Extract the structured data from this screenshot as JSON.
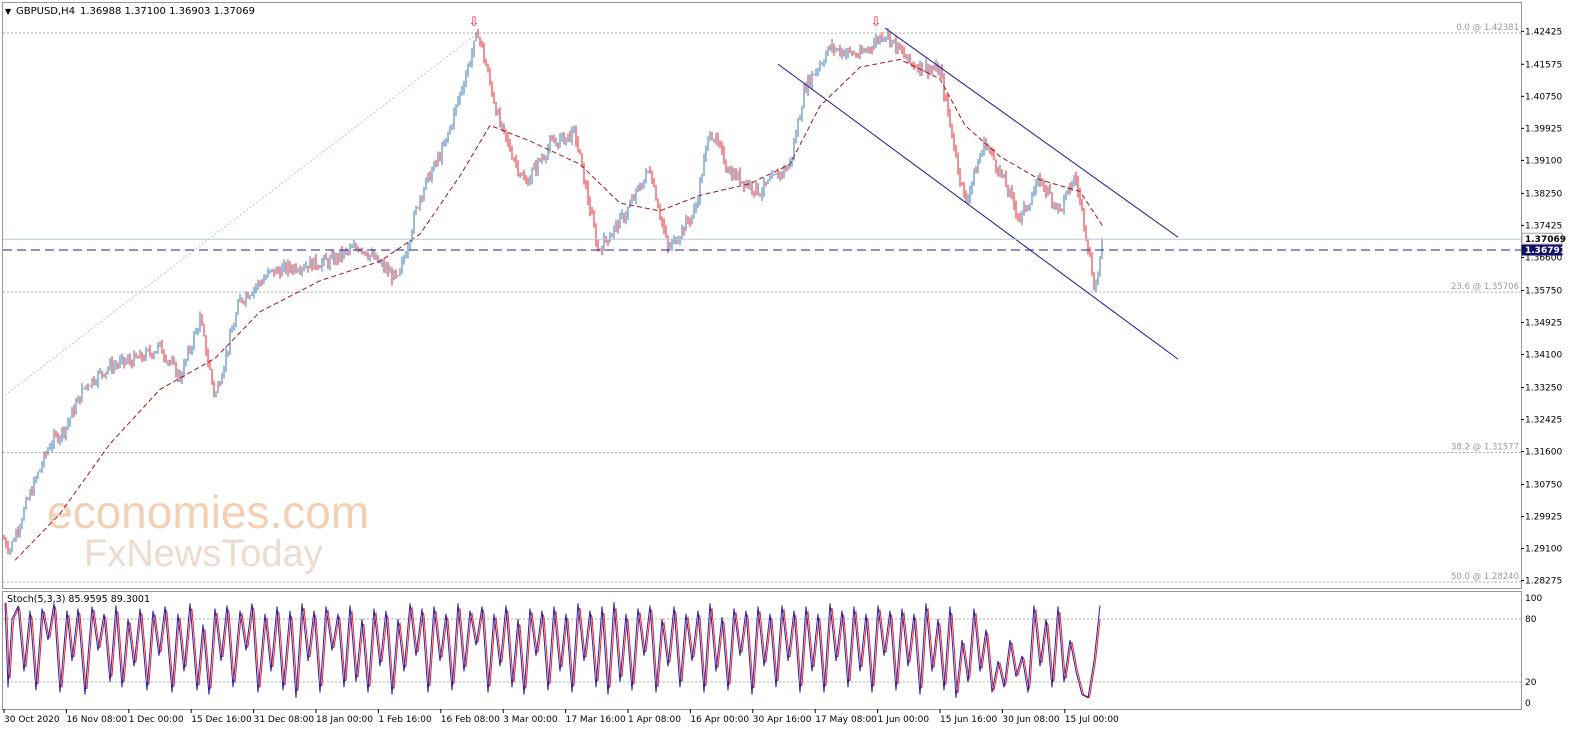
{
  "header": {
    "arrow_glyph": "▼",
    "symbol_label": "GBPUSD,H4",
    "ohlc": "1.36988 1.37100 1.36903 1.37069"
  },
  "watermark": {
    "line1": "economies.com",
    "line2": "FxNewsToday",
    "color": "#f3d0b4"
  },
  "colors": {
    "bull": "#3a78b4",
    "bear": "#e8202a",
    "ma": "#a01818",
    "channel": "#1a1a8c",
    "hline": "#2020a0",
    "stoch_main": "#2222aa",
    "stoch_signal": "#e8202a",
    "badge_bg": "#10106a"
  },
  "chart_data": [
    {
      "type": "candlestick",
      "symbol": "GBPUSD",
      "timeframe": "H4",
      "y_range": [
        1.2824,
        1.4251
      ],
      "y_ticks": [
        "1.42425",
        "1.41575",
        "1.40750",
        "1.39925",
        "1.39100",
        "1.38250",
        "1.37425",
        "1.36600",
        "1.35750",
        "1.34925",
        "1.34100",
        "1.33250",
        "1.32425",
        "1.31600",
        "1.30750",
        "1.29925",
        "1.29100",
        "1.28275"
      ],
      "x_ticks": [
        "30 Oct 2020",
        "16 Nov 08:00",
        "1 Dec 00:00",
        "15 Dec 16:00",
        "31 Dec 08:00",
        "18 Jan 00:00",
        "1 Feb 16:00",
        "16 Feb 08:00",
        "3 Mar 00:00",
        "17 Mar 16:00",
        "1 Apr 08:00",
        "16 Apr 00:00",
        "30 Apr 16:00",
        "17 May 08:00",
        "1 Jun 00:00",
        "15 Jun 16:00",
        "30 Jun 08:00",
        "15 Jul 00:00"
      ],
      "price_path": [
        [
          0,
          1.295
        ],
        [
          10,
          1.291
        ],
        [
          30,
          1.305
        ],
        [
          50,
          1.318
        ],
        [
          65,
          1.322
        ],
        [
          85,
          1.333
        ],
        [
          110,
          1.338
        ],
        [
          140,
          1.34
        ],
        [
          160,
          1.343
        ],
        [
          180,
          1.335
        ],
        [
          200,
          1.35
        ],
        [
          215,
          1.33
        ],
        [
          240,
          1.355
        ],
        [
          270,
          1.362
        ],
        [
          300,
          1.364
        ],
        [
          330,
          1.365
        ],
        [
          360,
          1.369
        ],
        [
          398,
          1.36
        ],
        [
          420,
          1.382
        ],
        [
          445,
          1.395
        ],
        [
          478,
          1.424
        ],
        [
          500,
          1.4
        ],
        [
          525,
          1.385
        ],
        [
          550,
          1.395
        ],
        [
          575,
          1.398
        ],
        [
          598,
          1.368
        ],
        [
          625,
          1.377
        ],
        [
          650,
          1.389
        ],
        [
          668,
          1.368
        ],
        [
          695,
          1.378
        ],
        [
          710,
          1.399
        ],
        [
          730,
          1.388
        ],
        [
          760,
          1.383
        ],
        [
          790,
          1.39
        ],
        [
          805,
          1.41
        ],
        [
          830,
          1.42
        ],
        [
          860,
          1.418
        ],
        [
          885,
          1.424
        ],
        [
          910,
          1.416
        ],
        [
          940,
          1.414
        ],
        [
          965,
          1.38
        ],
        [
          985,
          1.396
        ],
        [
          1000,
          1.388
        ],
        [
          1020,
          1.376
        ],
        [
          1040,
          1.386
        ],
        [
          1060,
          1.378
        ],
        [
          1075,
          1.387
        ],
        [
          1085,
          1.374
        ],
        [
          1095,
          1.3575
        ],
        [
          1103,
          1.3707
        ]
      ],
      "moving_average_path": [
        [
          15,
          1.288
        ],
        [
          60,
          1.3
        ],
        [
          110,
          1.318
        ],
        [
          160,
          1.332
        ],
        [
          215,
          1.34
        ],
        [
          260,
          1.352
        ],
        [
          320,
          1.36
        ],
        [
          380,
          1.365
        ],
        [
          420,
          1.372
        ],
        [
          460,
          1.387
        ],
        [
          490,
          1.4
        ],
        [
          530,
          1.396
        ],
        [
          580,
          1.39
        ],
        [
          620,
          1.38
        ],
        [
          660,
          1.378
        ],
        [
          700,
          1.382
        ],
        [
          750,
          1.385
        ],
        [
          790,
          1.39
        ],
        [
          820,
          1.405
        ],
        [
          860,
          1.415
        ],
        [
          900,
          1.417
        ],
        [
          940,
          1.412
        ],
        [
          965,
          1.4
        ],
        [
          1000,
          1.392
        ],
        [
          1040,
          1.386
        ],
        [
          1080,
          1.383
        ],
        [
          1103,
          1.374
        ]
      ],
      "horizontal_levels": [
        {
          "price": 1.42381,
          "label": "0.0 @ 1.42381",
          "style": "fibonacci"
        },
        {
          "price": 1.35706,
          "label": "23.6 @ 1.35706",
          "style": "fibonacci"
        },
        {
          "price": 1.31577,
          "label": "38.2 @ 1.31577",
          "style": "fibonacci"
        },
        {
          "price": 1.2824,
          "label": "50.0 @ 1.28240",
          "style": "fibonacci"
        },
        {
          "price": 1.36791,
          "label": "1.36791",
          "style": "support"
        },
        {
          "price": 1.37069,
          "label": "1.37069",
          "style": "bid"
        }
      ],
      "channel_lines": [
        {
          "from": [
            885,
            1.4251
          ],
          "to": [
            1178,
            1.3712
          ]
        },
        {
          "from": [
            778,
            1.4158
          ],
          "to": [
            1178,
            1.3398
          ]
        }
      ],
      "fib_anchor": {
        "from": [
          5,
          1.3305
        ],
        "to": [
          478,
          1.4238
        ]
      },
      "top_markers": [
        {
          "glyph": "⇩",
          "x": 474
        },
        {
          "glyph": "⇩",
          "x": 876
        }
      ]
    },
    {
      "type": "line",
      "indicator_label": "Stoch(5,3,3) 85.9595 89.3001",
      "y_range": [
        0,
        100
      ],
      "y_ticks": [
        "100",
        "80",
        "20",
        "0"
      ],
      "levels": [
        80,
        20
      ],
      "extrema_path": [
        [
          5,
          95
        ],
        [
          8,
          15
        ],
        [
          12,
          80
        ],
        [
          18,
          92
        ],
        [
          24,
          30
        ],
        [
          30,
          88
        ],
        [
          36,
          12
        ],
        [
          42,
          90
        ],
        [
          48,
          60
        ],
        [
          54,
          95
        ],
        [
          60,
          10
        ],
        [
          67,
          88
        ],
        [
          72,
          40
        ],
        [
          78,
          90
        ],
        [
          85,
          8
        ],
        [
          92,
          92
        ],
        [
          98,
          50
        ],
        [
          104,
          85
        ],
        [
          110,
          20
        ],
        [
          116,
          93
        ],
        [
          122,
          15
        ],
        [
          128,
          80
        ],
        [
          134,
          35
        ],
        [
          140,
          90
        ],
        [
          147,
          12
        ],
        [
          153,
          88
        ],
        [
          159,
          45
        ],
        [
          165,
          92
        ],
        [
          172,
          10
        ],
        [
          178,
          85
        ],
        [
          184,
          30
        ],
        [
          190,
          95
        ],
        [
          197,
          12
        ],
        [
          203,
          75
        ],
        [
          209,
          8
        ],
        [
          215,
          90
        ],
        [
          221,
          40
        ],
        [
          227,
          93
        ],
        [
          233,
          15
        ],
        [
          240,
          88
        ],
        [
          246,
          50
        ],
        [
          252,
          95
        ],
        [
          258,
          10
        ],
        [
          265,
          85
        ],
        [
          271,
          30
        ],
        [
          277,
          92
        ],
        [
          283,
          12
        ],
        [
          290,
          88
        ],
        [
          296,
          5
        ],
        [
          302,
          95
        ],
        [
          308,
          40
        ],
        [
          314,
          88
        ],
        [
          320,
          10
        ],
        [
          326,
          92
        ],
        [
          332,
          50
        ],
        [
          338,
          85
        ],
        [
          344,
          15
        ],
        [
          350,
          93
        ],
        [
          356,
          20
        ],
        [
          362,
          80
        ],
        [
          368,
          10
        ],
        [
          374,
          90
        ],
        [
          380,
          35
        ],
        [
          386,
          88
        ],
        [
          392,
          8
        ],
        [
          398,
          80
        ],
        [
          404,
          30
        ],
        [
          410,
          95
        ],
        [
          416,
          45
        ],
        [
          422,
          90
        ],
        [
          428,
          10
        ],
        [
          434,
          92
        ],
        [
          440,
          40
        ],
        [
          446,
          85
        ],
        [
          452,
          12
        ],
        [
          458,
          95
        ],
        [
          464,
          30
        ],
        [
          470,
          88
        ],
        [
          476,
          55
        ],
        [
          482,
          92
        ],
        [
          488,
          10
        ],
        [
          494,
          85
        ],
        [
          500,
          35
        ],
        [
          506,
          93
        ],
        [
          512,
          15
        ],
        [
          518,
          80
        ],
        [
          524,
          8
        ],
        [
          530,
          90
        ],
        [
          536,
          45
        ],
        [
          542,
          88
        ],
        [
          548,
          12
        ],
        [
          554,
          92
        ],
        [
          560,
          30
        ],
        [
          566,
          85
        ],
        [
          572,
          10
        ],
        [
          578,
          95
        ],
        [
          584,
          40
        ],
        [
          590,
          88
        ],
        [
          596,
          15
        ],
        [
          602,
          92
        ],
        [
          608,
          8
        ],
        [
          614,
          96
        ],
        [
          620,
          20
        ],
        [
          626,
          85
        ],
        [
          632,
          12
        ],
        [
          638,
          90
        ],
        [
          644,
          45
        ],
        [
          650,
          93
        ],
        [
          656,
          10
        ],
        [
          662,
          80
        ],
        [
          668,
          35
        ],
        [
          674,
          92
        ],
        [
          680,
          15
        ],
        [
          686,
          85
        ],
        [
          692,
          40
        ],
        [
          698,
          88
        ],
        [
          704,
          10
        ],
        [
          710,
          95
        ],
        [
          716,
          30
        ],
        [
          722,
          82
        ],
        [
          728,
          12
        ],
        [
          734,
          90
        ],
        [
          740,
          45
        ],
        [
          746,
          88
        ],
        [
          752,
          8
        ],
        [
          758,
          92
        ],
        [
          764,
          35
        ],
        [
          770,
          85
        ],
        [
          776,
          15
        ],
        [
          782,
          93
        ],
        [
          788,
          40
        ],
        [
          794,
          88
        ],
        [
          800,
          10
        ],
        [
          806,
          92
        ],
        [
          812,
          30
        ],
        [
          818,
          85
        ],
        [
          824,
          10
        ],
        [
          830,
          95
        ],
        [
          836,
          40
        ],
        [
          842,
          88
        ],
        [
          848,
          15
        ],
        [
          854,
          92
        ],
        [
          860,
          30
        ],
        [
          866,
          85
        ],
        [
          872,
          10
        ],
        [
          878,
          93
        ],
        [
          884,
          45
        ],
        [
          890,
          88
        ],
        [
          896,
          12
        ],
        [
          902,
          90
        ],
        [
          908,
          35
        ],
        [
          914,
          85
        ],
        [
          920,
          8
        ],
        [
          926,
          95
        ],
        [
          932,
          30
        ],
        [
          938,
          80
        ],
        [
          944,
          12
        ],
        [
          950,
          92
        ],
        [
          956,
          5
        ],
        [
          962,
          60
        ],
        [
          968,
          20
        ],
        [
          974,
          90
        ],
        [
          980,
          30
        ],
        [
          986,
          70
        ],
        [
          992,
          10
        ],
        [
          998,
          40
        ],
        [
          1004,
          15
        ],
        [
          1010,
          60
        ],
        [
          1016,
          25
        ],
        [
          1022,
          45
        ],
        [
          1028,
          10
        ],
        [
          1034,
          93
        ],
        [
          1040,
          35
        ],
        [
          1046,
          80
        ],
        [
          1052,
          15
        ],
        [
          1058,
          92
        ],
        [
          1064,
          20
        ],
        [
          1070,
          60
        ],
        [
          1076,
          30
        ],
        [
          1082,
          8
        ],
        [
          1088,
          5
        ],
        [
          1094,
          40
        ],
        [
          1100,
          93
        ]
      ]
    }
  ]
}
